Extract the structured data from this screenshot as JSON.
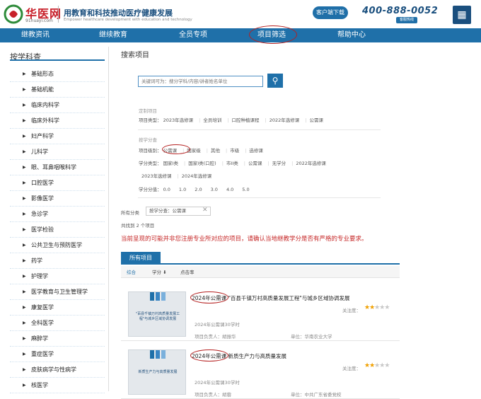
{
  "header": {
    "logo_cn": "华医网",
    "logo_en": "91huayi.com",
    "slogan_cn": "用教育和科技推动医疗健康发展",
    "slogan_en": "Empower healthcare development with education and technology",
    "download_label": "客户端下载",
    "phone": "400-888-0052",
    "phone_sub": "客服热线"
  },
  "nav": [
    "继教资讯",
    "继续教育",
    "全员专项",
    "项目筛选",
    "帮助中心"
  ],
  "sidebar": {
    "title": "按学科查",
    "items": [
      "基础形态",
      "基础机能",
      "临床内科学",
      "临床外科学",
      "妇产科学",
      "儿科学",
      "眼、耳鼻咽喉科学",
      "口腔医学",
      "影像医学",
      "急诊学",
      "医学检验",
      "公共卫生与预防医学",
      "药学",
      "护理学",
      "医学教育与卫生管理学",
      "康复医学",
      "全科医学",
      "麻醉学",
      "重症医学",
      "皮肤病学与性病学",
      "核医学"
    ]
  },
  "main": {
    "title": "搜索项目",
    "search_placeholder": "关键词可为：搜分学科/内容/讲者姓名单位",
    "search_icon": "search-icon",
    "custom": {
      "heading": "定制项目",
      "label": "项目类型：",
      "options": [
        "2023年选修课",
        "全员培训",
        "口腔种植课程",
        "2022年选修课",
        "公需课"
      ]
    },
    "bycredit": {
      "heading": "按学分查",
      "level_label": "项目级别：",
      "level_options": [
        "公需课",
        "国家级",
        "其他",
        "市级",
        "选修课"
      ],
      "type_label": "学分类型：",
      "type_options": [
        "国家I类",
        "国家I类(口腔)",
        "市II类",
        "公需课",
        "无学分",
        "2022年选修课"
      ],
      "type_options2": [
        "2023年选修课",
        "2024年选修课"
      ],
      "credit_label": "学分分值：",
      "credit_options": [
        "0.0",
        "1.0",
        "2.0",
        "3.0",
        "4.0",
        "5.0"
      ]
    },
    "all_categories": "所有分类",
    "active_tag": "按学分查：公需课",
    "found": "共找到 2 个项目",
    "warning": "当前呈现的可能并非您注册专业所对应的项目，请确认当地继教学分是否有严格的专业要求。",
    "tab_all": "所有项目",
    "sort": [
      "综合",
      "学分 ⬇",
      "点击率"
    ],
    "courses": [
      {
        "badge": "2024年公需课",
        "title": "\"百县千镇万村高质量发展工程\"与城乡区域协调发展",
        "hours": "2024年公需课30学时",
        "leader": "项目负责人：胡振华",
        "unit": "单位：华南农业大学",
        "attention": "关注度：",
        "stars": 2,
        "thumb_text": "\"百县千镇万村高质量发展工程\"与城乡区域协调发展"
      },
      {
        "badge": "2024年公需课",
        "title": "新质生产力与高质量发展",
        "hours": "2024年公需课30学时",
        "leader": "项目负责人：胡蓉",
        "unit": "单位：中共广东省委党校",
        "attention": "关注度：",
        "stars": 2,
        "thumb_text": "新质生产力与高质量发展"
      }
    ]
  }
}
